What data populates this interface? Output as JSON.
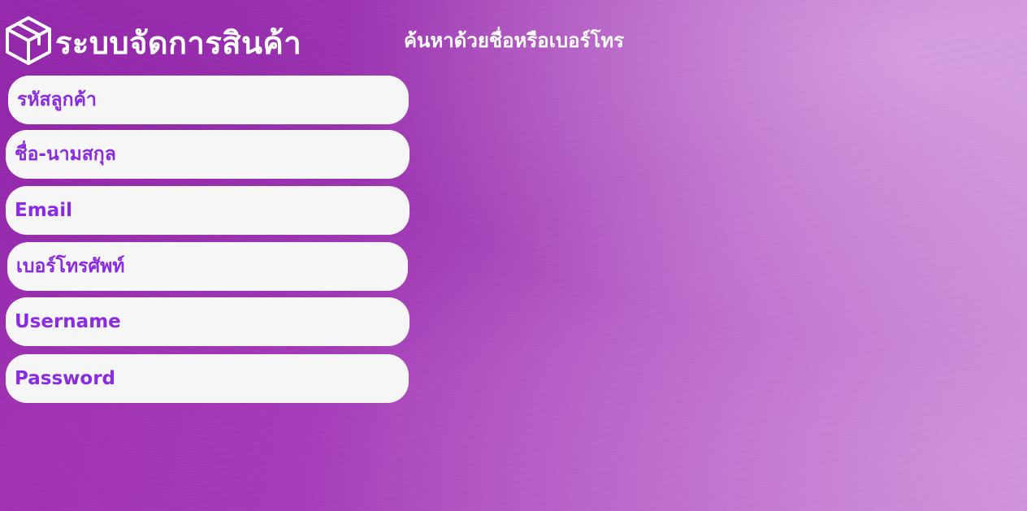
{
  "header": {
    "app_title": "ระบบจัดการสินค้า",
    "logo_icon": "package-box-icon",
    "search_hint": "ค้นหาด้วยชื่อหรือเบอร์โทร"
  },
  "form": {
    "fields": [
      {
        "label": "รหัสลูกค้า",
        "value": ""
      },
      {
        "label": "ชื่อ-นามสกุล",
        "value": ""
      },
      {
        "label": "Email",
        "value": ""
      },
      {
        "label": "เบอร์โทรศัพท์",
        "value": ""
      },
      {
        "label": "Username",
        "value": ""
      },
      {
        "label": "Password",
        "value": ""
      }
    ]
  },
  "colors": {
    "background_start": "#9e2fb2",
    "background_end": "#c98bd6",
    "field_background": "#f6f6f6",
    "field_text": "#8a2be2",
    "header_text": "#ffffff"
  }
}
